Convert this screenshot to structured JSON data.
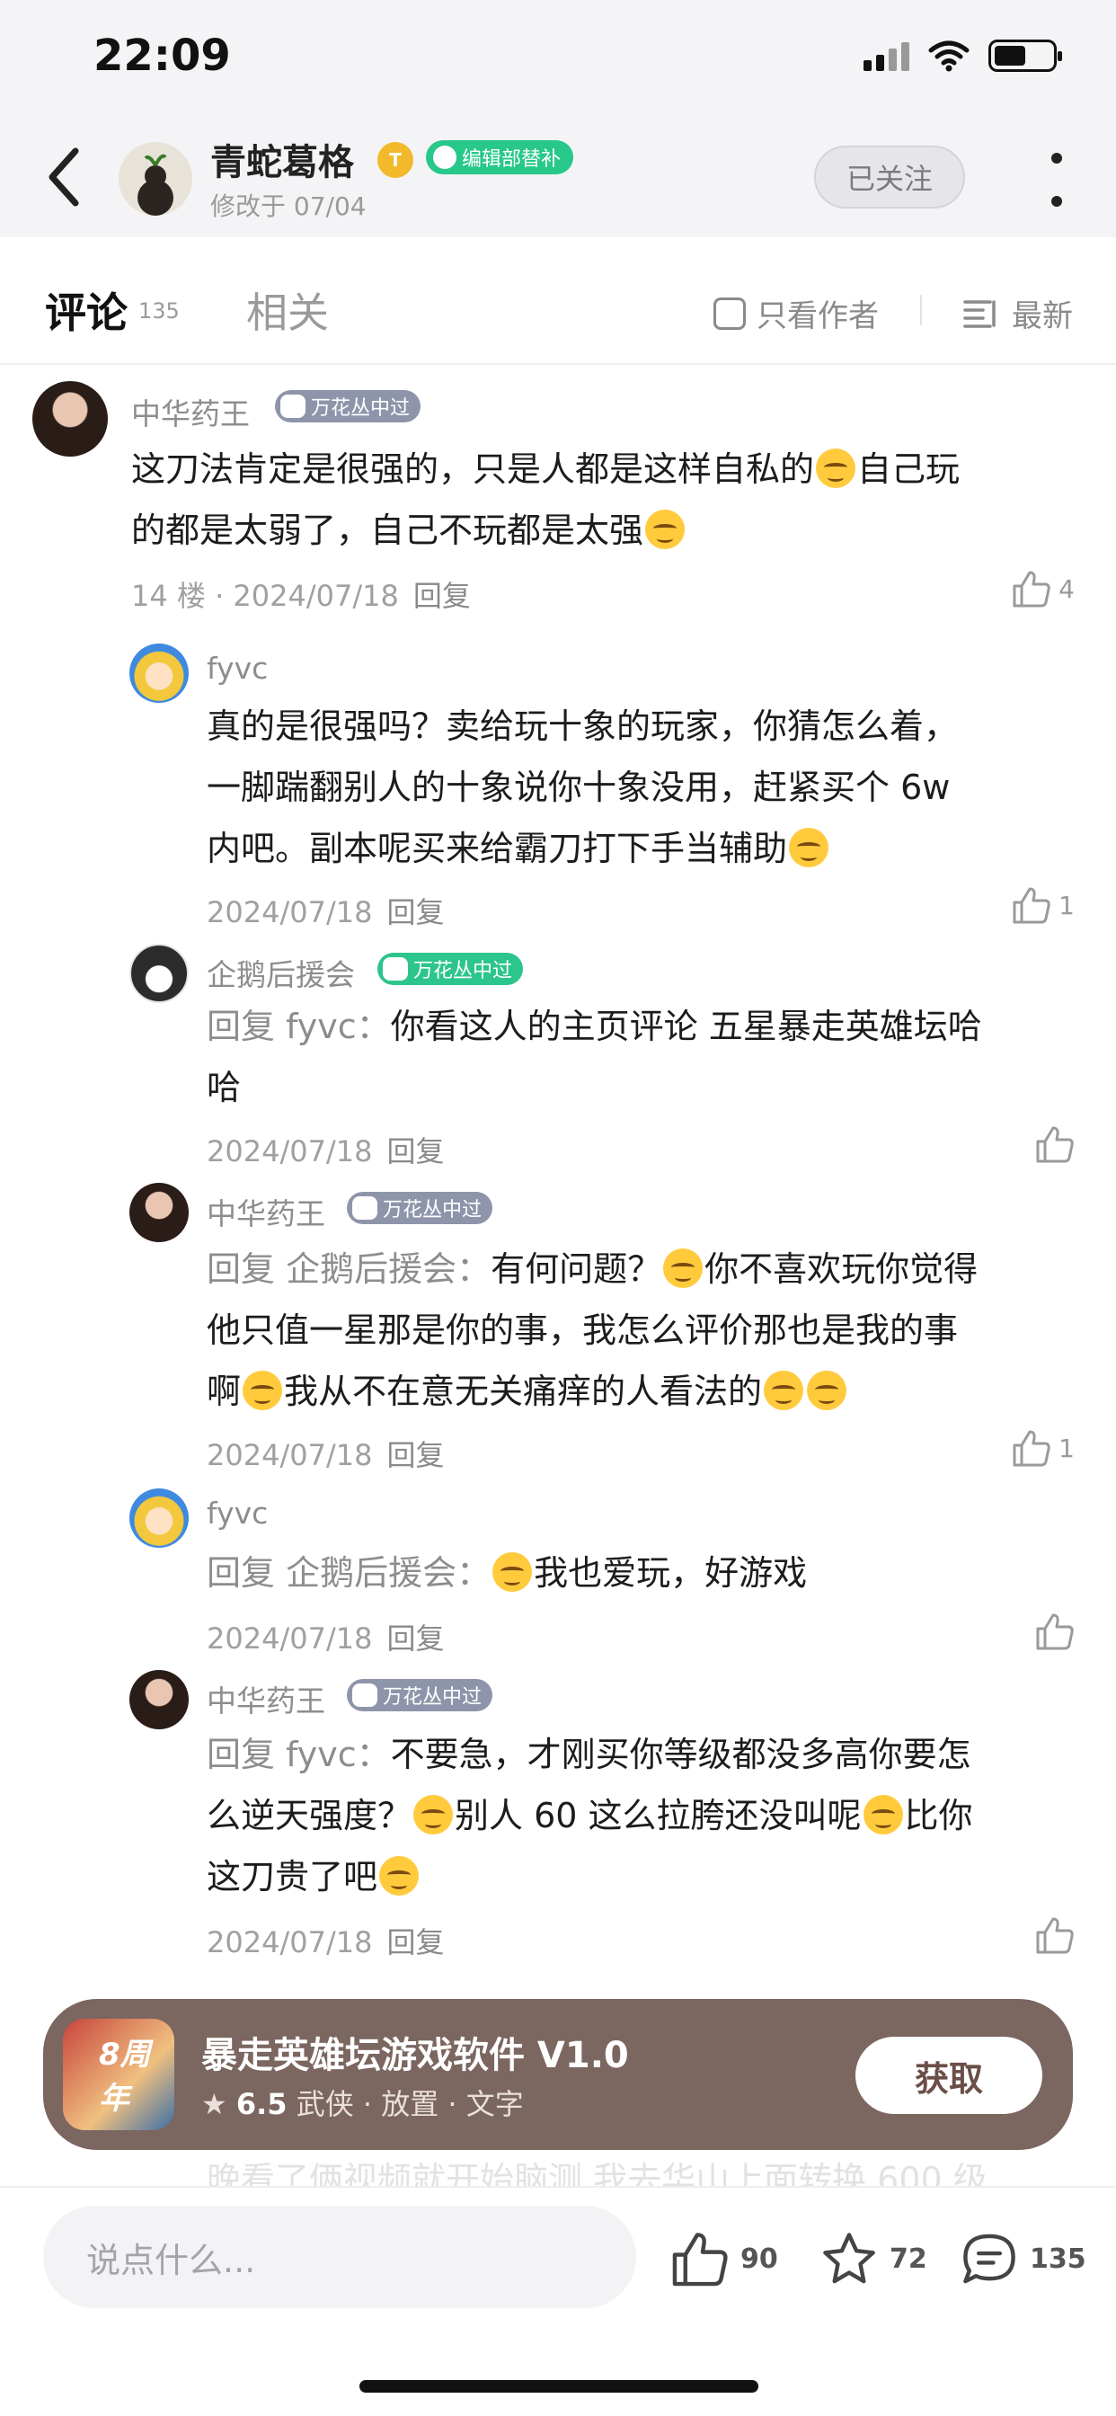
{
  "status": {
    "time": "22:09"
  },
  "header": {
    "author_name": "青蛇葛格",
    "level_badge": "T",
    "editor_badge": "编辑部替补",
    "modified": "修改于 07/04",
    "follow_label": "已关注"
  },
  "tabs": {
    "comments_label": "评论",
    "comments_count": "135",
    "related_label": "相关",
    "only_author_label": "只看作者",
    "sort_label": "最新"
  },
  "comments": [
    {
      "user": "中华药王",
      "badge": "万花丛中过",
      "text": [
        "这刀法肯定是很强的，只是人都是这样自私的",
        "自己玩",
        "的都是太弱了，自己不玩都是太强"
      ],
      "meta": "14 楼 · 2024/07/18",
      "reply_label": "回复",
      "likes": "4"
    },
    {
      "user": "fyvc",
      "text": [
        "真的是很强吗？卖给玩十象的玩家，你猜怎么着，",
        "一脚踹翻别人的十象说你十象没用，赶紧买个 6w",
        "内吧。副本呢买来给霸刀打下手当辅助"
      ],
      "meta": "2024/07/18",
      "reply_label": "回复",
      "likes": "1"
    },
    {
      "user": "企鹅后援会",
      "badge": "万花丛中过",
      "reply_prefix": "回复 fyvc：",
      "text": [
        "你看这人的主页评论 五星暴走英雄坛哈",
        "哈"
      ],
      "meta": "2024/07/18",
      "reply_label": "回复",
      "likes": ""
    },
    {
      "user": "中华药王",
      "badge": "万花丛中过",
      "reply_prefix": "回复 企鹅后援会：",
      "text": [
        "有何问题？",
        "你不喜欢玩你觉得",
        "他只值一星那是你的事，我怎么评价那也是我的事",
        "啊",
        "我从不在意无关痛痒的人看法的"
      ],
      "meta": "2024/07/18",
      "reply_label": "回复",
      "likes": "1"
    },
    {
      "user": "fyvc",
      "reply_prefix": "回复 企鹅后援会：",
      "text": [
        "我也爱玩，好游戏"
      ],
      "meta": "2024/07/18",
      "reply_label": "回复",
      "likes": ""
    },
    {
      "user": "中华药王",
      "badge": "万花丛中过",
      "reply_prefix": "回复 fyvc：",
      "text": [
        "不要急，才刚买你等级都没多高你要怎",
        "么逆天强度？",
        "别人 60 这么拉胯还没叫呢",
        "比你",
        "这刀贵了吧"
      ],
      "meta": "2024/07/18",
      "reply_label": "回复",
      "likes": ""
    }
  ],
  "banner": {
    "icon_text": "8周年",
    "title": "暴走英雄坛游戏软件 V1.0",
    "rating": "6.5",
    "tags": "武侠 · 放置 · 文字",
    "get_label": "获取"
  },
  "faded_line": "晚看了俩视频就开始脑测 我去华山上面转换 600 级",
  "bottom": {
    "input_placeholder": "说点什么...",
    "likes": "90",
    "favorites": "72",
    "comments": "135"
  }
}
